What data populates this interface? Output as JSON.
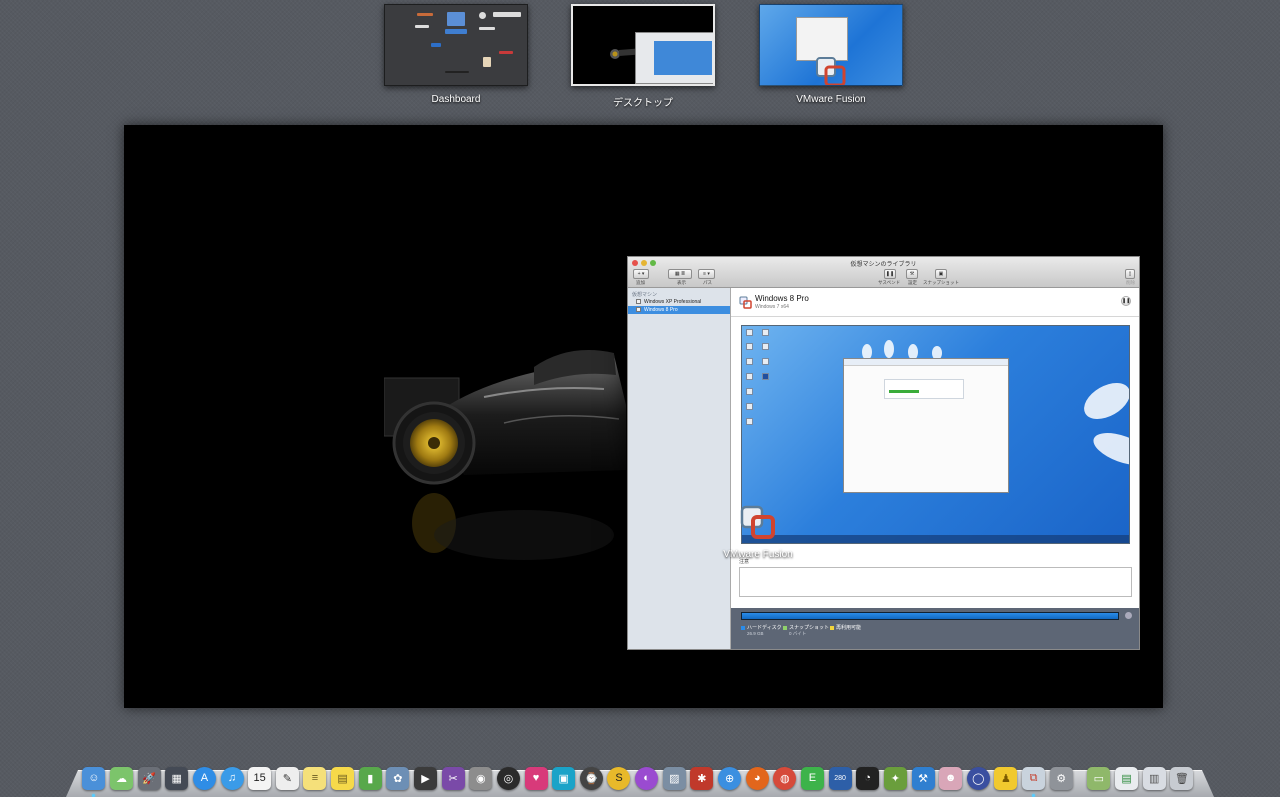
{
  "spaces": [
    {
      "label": "Dashboard"
    },
    {
      "label": "デスクトップ",
      "selected": true
    },
    {
      "label": "VMware Fusion"
    }
  ],
  "library_window": {
    "title": "仮想マシンのライブラリ",
    "toolbar": {
      "add_label": "追加",
      "view_label": "表示",
      "path_label": "パス",
      "suspend_label": "サスペンド",
      "settings_label": "設定",
      "snapshot_label": "スナップショット",
      "delete_label": "削除"
    },
    "sidebar": {
      "heading": "仮想マシン",
      "items": [
        {
          "label": "Windows XP Professional"
        },
        {
          "label": "Windows 8 Pro",
          "selected": true
        }
      ]
    },
    "detail": {
      "vm_name": "Windows 8 Pro",
      "vm_os": "Windows 7 x64",
      "notes_label": "注意"
    },
    "disk": {
      "legend": [
        {
          "label": "ハードディスク",
          "color": "#2b8ce8",
          "sub": "26.9 GB"
        },
        {
          "label": "スナップショット",
          "color": "#8fd16b",
          "sub": "0 バイト"
        },
        {
          "label": "再利用可能",
          "color": "#f2d53c",
          "sub": ""
        }
      ],
      "used_fraction": 1.0
    }
  },
  "app_label": "VMware Fusion",
  "dock": {
    "items": [
      {
        "name": "finder",
        "icon": "☺",
        "bg": "#4a90d9",
        "running": true
      },
      {
        "name": "icloud",
        "icon": "☁",
        "bg": "#7cc46b",
        "running": false
      },
      {
        "name": "launchpad",
        "icon": "🚀",
        "bg": "#6b6f77",
        "running": false
      },
      {
        "name": "mission-control",
        "icon": "▦",
        "bg": "#444a55",
        "running": false
      },
      {
        "name": "app-store",
        "icon": "A",
        "bg": "#2f8de6",
        "running": false,
        "round": true
      },
      {
        "name": "itunes",
        "icon": "♫",
        "bg": "#3a9be8",
        "running": false,
        "round": true
      },
      {
        "name": "calendar",
        "icon": "15",
        "bg": "#f4f4f4",
        "fg": "#222",
        "running": false
      },
      {
        "name": "textedit",
        "icon": "✎",
        "bg": "#eeeeee",
        "fg": "#333",
        "running": false
      },
      {
        "name": "notes",
        "icon": "≡",
        "bg": "#f5e07a",
        "fg": "#6a5a20",
        "running": false
      },
      {
        "name": "stickies",
        "icon": "▤",
        "bg": "#f6d94a",
        "fg": "#6a5a20",
        "running": false
      },
      {
        "name": "numbers",
        "icon": "▮",
        "bg": "#58a84b",
        "running": false
      },
      {
        "name": "iphoto",
        "icon": "✿",
        "bg": "#6d8fb5",
        "running": false
      },
      {
        "name": "imovie",
        "icon": "▶",
        "bg": "#3b3b3b",
        "running": false
      },
      {
        "name": "final-cut",
        "icon": "✂",
        "bg": "#7a4aa8",
        "running": false
      },
      {
        "name": "photo-booth",
        "icon": "◉",
        "bg": "#8d8d8d",
        "running": false
      },
      {
        "name": "aperture",
        "icon": "◎",
        "bg": "#2b2b2b",
        "running": false,
        "round": true
      },
      {
        "name": "heart-app",
        "icon": "♥",
        "bg": "#d83a7a",
        "running": false
      },
      {
        "name": "preview",
        "icon": "▣",
        "bg": "#1aa3c8",
        "running": false
      },
      {
        "name": "time-machine",
        "icon": "⌚",
        "bg": "#444",
        "running": false,
        "round": true
      },
      {
        "name": "s-app",
        "icon": "S",
        "bg": "#e8b92a",
        "fg": "#222",
        "running": false,
        "round": true
      },
      {
        "name": "color-app",
        "icon": "◐",
        "bg": "#9a4bd0",
        "running": false,
        "round": true
      },
      {
        "name": "image-capture",
        "icon": "▨",
        "bg": "#7b8ea3",
        "running": false
      },
      {
        "name": "script-app",
        "icon": "✱",
        "bg": "#c0392b",
        "running": false
      },
      {
        "name": "safari",
        "icon": "⊕",
        "bg": "#3b8fe0",
        "running": false,
        "round": true
      },
      {
        "name": "firefox",
        "icon": "◕",
        "bg": "#e2661c",
        "running": false,
        "round": true
      },
      {
        "name": "chrome",
        "icon": "◍",
        "bg": "#d64a3a",
        "running": false,
        "round": true
      },
      {
        "name": "evernote",
        "icon": "E",
        "bg": "#3db34a",
        "running": false
      },
      {
        "name": "highway-app",
        "icon": "280",
        "bg": "#2d5fa8",
        "running": false
      },
      {
        "name": "dvd-player",
        "icon": "◔",
        "bg": "#222",
        "running": false
      },
      {
        "name": "pineapple-app",
        "icon": "✦",
        "bg": "#6a9e3c",
        "running": false
      },
      {
        "name": "xcode",
        "icon": "⚒",
        "bg": "#2f7fd0",
        "running": false
      },
      {
        "name": "cat-app",
        "icon": "☻",
        "bg": "#d9a6b8",
        "running": false
      },
      {
        "name": "globe-app",
        "icon": "◯",
        "bg": "#3a4fa0",
        "running": false,
        "round": true
      },
      {
        "name": "duck-app",
        "icon": "♟",
        "bg": "#f1c92e",
        "fg": "#7a5a00",
        "running": false
      },
      {
        "name": "vmware-fusion",
        "icon": "⧉",
        "bg": "#c9d3dd",
        "fg": "#c4402f",
        "running": true
      },
      {
        "name": "system-preferences",
        "icon": "⚙",
        "bg": "#8f9399",
        "running": false
      },
      {
        "name": "separator"
      },
      {
        "name": "applications-folder",
        "icon": "▭",
        "bg": "#8fb86a",
        "running": false
      },
      {
        "name": "documents-stack",
        "icon": "▤",
        "bg": "#e9ecef",
        "fg": "#2a8a3a",
        "running": false
      },
      {
        "name": "downloads-stack",
        "icon": "▥",
        "bg": "#d8dce2",
        "fg": "#555",
        "running": false
      },
      {
        "name": "trash",
        "icon": "🗑",
        "bg": "#c7cbd1",
        "fg": "#444",
        "running": false
      }
    ]
  }
}
